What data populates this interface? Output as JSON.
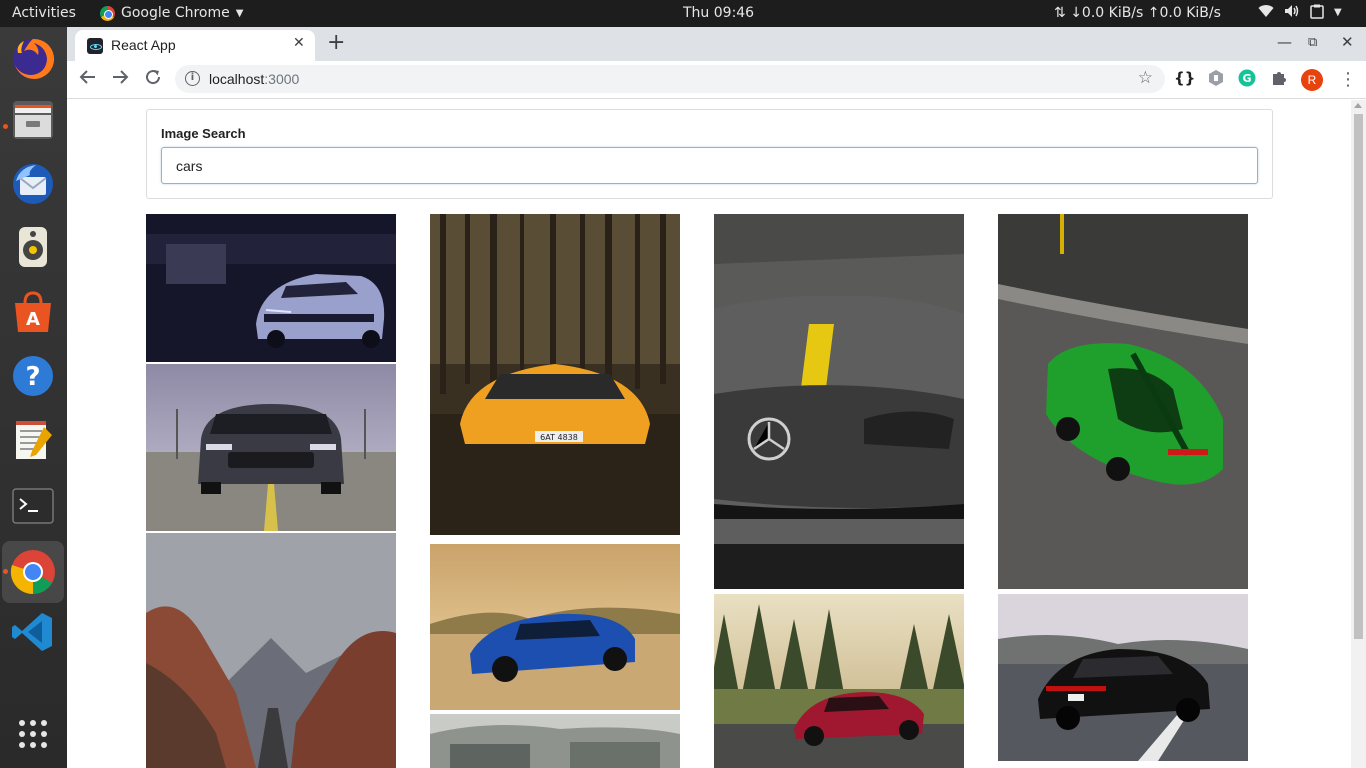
{
  "topbar": {
    "activities": "Activities",
    "app_name": "Google Chrome",
    "clock": "Thu 09:46",
    "net_speed": "↓0.0 KiB/s ↑0.0 KiB/s"
  },
  "dock": {
    "items": [
      "firefox",
      "file-manager",
      "thunderbird",
      "rhythmbox",
      "software-center",
      "help",
      "text-editor",
      "terminal",
      "chrome",
      "vscode",
      "show-apps"
    ]
  },
  "browser": {
    "tab_title": "React App",
    "url_host": "localhost",
    "url_port": ":3000",
    "avatar_initial": "R"
  },
  "search": {
    "label": "Image Search",
    "value": "cars"
  },
  "gallery": {
    "photos": [
      {
        "subject": "silver camaro in dark garage",
        "colors": [
          "#1a1a2e",
          "#2b2b45",
          "#8a8fb8"
        ]
      },
      {
        "subject": "grey mustang front view",
        "colors": [
          "#b9b5c9",
          "#8c8a9c",
          "#2e2e36"
        ]
      },
      {
        "subject": "road through red canyon",
        "colors": [
          "#9fa2a8",
          "#8b4a35",
          "#5b3a2e"
        ]
      },
      {
        "subject": "orange lamborghini in forest",
        "colors": [
          "#4a3d2a",
          "#2b2218",
          "#f0a020"
        ]
      },
      {
        "subject": "blue camaro in desert",
        "colors": [
          "#e8c590",
          "#c9a873",
          "#1d4fb0"
        ]
      },
      {
        "subject": "parked cars",
        "colors": [
          "#c8cbc6",
          "#8e948d",
          "#5e6460"
        ]
      },
      {
        "subject": "grey mercedes with yellow stripe",
        "colors": [
          "#6b6b6b",
          "#3a3a3a",
          "#e6c812"
        ]
      },
      {
        "subject": "red mercedes amg near forest",
        "colors": [
          "#d8c89c",
          "#556b3a",
          "#a01830"
        ]
      },
      {
        "subject": "green mustang top view",
        "colors": [
          "#6e6b68",
          "#4b4947",
          "#1fa02c"
        ]
      },
      {
        "subject": "black porsche panamera on road",
        "colors": [
          "#dad5dc",
          "#55585e",
          "#111111"
        ]
      }
    ]
  }
}
